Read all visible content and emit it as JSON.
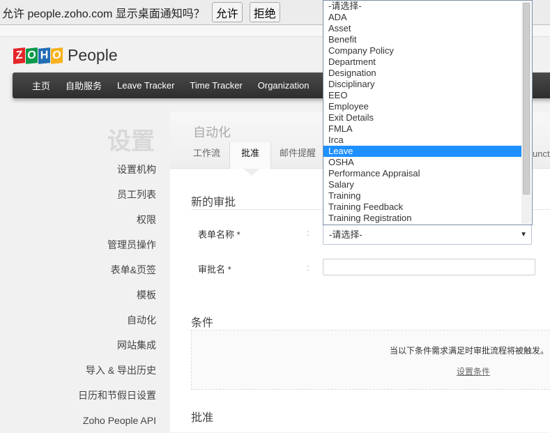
{
  "notification": {
    "text": "允许 people.zoho.com 显示桌面通知吗？",
    "allow": "允许",
    "deny": "拒绝"
  },
  "logo": {
    "letters": [
      "Z",
      "O",
      "H",
      "O"
    ],
    "product": "People"
  },
  "nav": [
    "主页",
    "自助服务",
    "Leave Tracker",
    "Time Tracker",
    "Organization"
  ],
  "sidebar": {
    "title": "设置",
    "items": [
      "设置机构",
      "员工列表",
      "权限",
      "管理员操作",
      "表单&页签",
      "模板",
      "自动化",
      "网站集成",
      "导入 & 导出历史",
      "日历和节假日设置",
      "Zoho People API"
    ]
  },
  "main": {
    "title": "自动化",
    "tabs": [
      "工作流",
      "批准",
      "邮件提醒"
    ],
    "tab_partial": "unct",
    "section_new": "新的审批",
    "form_label": "表单名称 *",
    "approval_label": "审批名 *",
    "colon": ":",
    "select_value": "-请选择-",
    "condition_title": "条件",
    "condition_desc": "当以下条件需求满足时审批流程将被触发。",
    "condition_link": "设置条件",
    "approval_title": "批准"
  },
  "dropdown": {
    "options": [
      "-请选择-",
      "ADA",
      "Asset",
      "Benefit",
      "Company Policy",
      "Department",
      "Designation",
      "Disciplinary",
      "EEO",
      "Employee",
      "Exit Details",
      "FMLA",
      "Irca",
      "Leave",
      "OSHA",
      "Performance Appraisal",
      "Salary",
      "Training",
      "Training Feedback",
      "Training Registration"
    ],
    "highlighted": "Leave"
  },
  "colors": {
    "highlight": "#1e90ff",
    "nav": "#3a3a3a"
  }
}
